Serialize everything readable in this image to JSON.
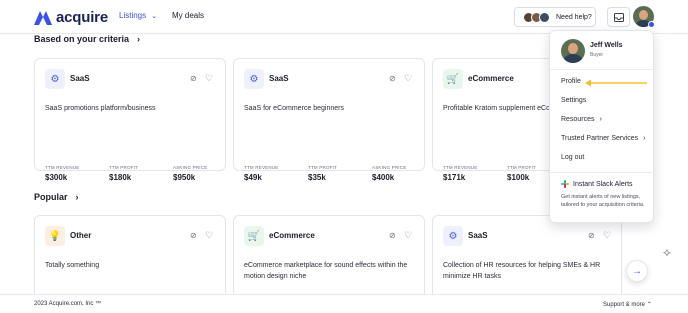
{
  "header": {
    "logo_text": "acquire",
    "nav_listings": "Listings",
    "nav_deals": "My deals",
    "help_label": "Need help?"
  },
  "sections": {
    "criteria_title": "Based on your criteria",
    "popular_title": "Popular"
  },
  "cards_criteria": [
    {
      "category": "SaaS",
      "desc": "SaaS promotions platform/business",
      "metrics": [
        {
          "label": "TTM REVENUE",
          "value": "$300k"
        },
        {
          "label": "TTM PROFIT",
          "value": "$180k"
        },
        {
          "label": "ASKING PRICE",
          "value": "$950k"
        }
      ]
    },
    {
      "category": "SaaS",
      "desc": "SaaS for eCommerce beginners",
      "metrics": [
        {
          "label": "TTM REVENUE",
          "value": "$49k"
        },
        {
          "label": "TTM PROFIT",
          "value": "$35k"
        },
        {
          "label": "ASKING PRICE",
          "value": "$400k"
        }
      ]
    },
    {
      "category": "eCommerce",
      "desc": "Profitable Kratom supplement eCom",
      "metrics": [
        {
          "label": "TTM REVENUE",
          "value": "$171k"
        },
        {
          "label": "TTM PROFIT",
          "value": "$100k"
        }
      ]
    }
  ],
  "cards_popular": [
    {
      "category": "Other",
      "desc": "Totally something"
    },
    {
      "category": "eCommerce",
      "desc": "eCommerce marketplace for sound effects within the motion design niche"
    },
    {
      "category": "SaaS",
      "desc": "Collection of HR resources for helping SMEs & HR minimize HR tasks"
    }
  ],
  "menu": {
    "name": "Jeff Wells",
    "role": "Buyer",
    "items": [
      "Profile",
      "Settings",
      "Resources",
      "Trusted Partner Services",
      "Log out"
    ],
    "slack_title": "Instant Slack Alerts",
    "slack_desc": "Get instant alerts of new listings, tailored to your acquisition criteria."
  },
  "footer": {
    "copyright": "2023 Acquire.com, Inc ™",
    "support": "Support & more"
  },
  "colors": {
    "accent": "#3b52e4",
    "arrow_annotation": "#f2c12e",
    "saas_bg": "#eef0fb",
    "ecom_bg": "#e9f6ec",
    "other_bg": "#fdeee4"
  },
  "icons": {
    "saas": "gear-icon",
    "ecommerce": "cart-icon",
    "other": "lightbulb-icon"
  }
}
